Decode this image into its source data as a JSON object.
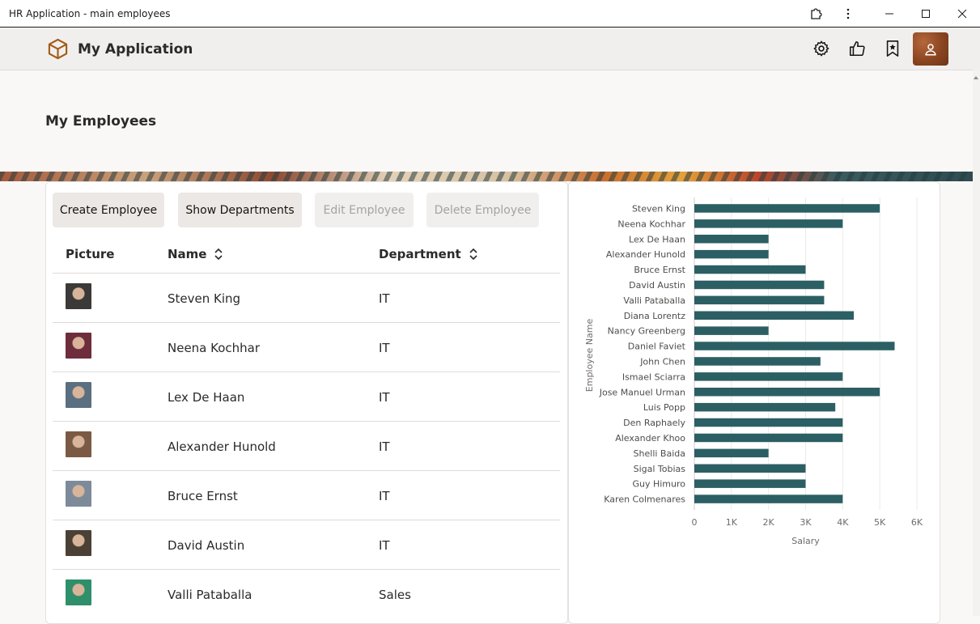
{
  "window": {
    "title": "HR Application - main employees"
  },
  "app": {
    "name": "My Application"
  },
  "page": {
    "title": "My Employees"
  },
  "toolbar": {
    "create_label": "Create Employee",
    "show_departments_label": "Show Departments",
    "edit_label": "Edit Employee",
    "delete_label": "Delete Employee"
  },
  "table": {
    "headers": {
      "picture": "Picture",
      "name": "Name",
      "department": "Department"
    },
    "rows": [
      {
        "name": "Steven King",
        "department": "IT",
        "photo_tone": "#3b3a38"
      },
      {
        "name": "Neena Kochhar",
        "department": "IT",
        "photo_tone": "#6d2d3a"
      },
      {
        "name": "Lex De Haan",
        "department": "IT",
        "photo_tone": "#5a6f80"
      },
      {
        "name": "Alexander Hunold",
        "department": "IT",
        "photo_tone": "#7a5a44"
      },
      {
        "name": "Bruce Ernst",
        "department": "IT",
        "photo_tone": "#7d8a99"
      },
      {
        "name": "David Austin",
        "department": "IT",
        "photo_tone": "#4a4035"
      },
      {
        "name": "Valli Pataballa",
        "department": "Sales",
        "photo_tone": "#2f8f6a"
      }
    ]
  },
  "colors": {
    "bar": "#2b5f64",
    "accent_avatar": "#8a4520",
    "logo": "#a35a16"
  },
  "chart_data": {
    "type": "bar",
    "orientation": "horizontal",
    "categories": [
      "Steven King",
      "Neena Kochhar",
      "Lex De Haan",
      "Alexander Hunold",
      "Bruce Ernst",
      "David Austin",
      "Valli Pataballa",
      "Diana Lorentz",
      "Nancy Greenberg",
      "Daniel Faviet",
      "John Chen",
      "Ismael Sciarra",
      "Jose Manuel Urman",
      "Luis Popp",
      "Den Raphaely",
      "Alexander Khoo",
      "Shelli Baida",
      "Sigal Tobias",
      "Guy Himuro",
      "Karen Colmenares"
    ],
    "values": [
      5000,
      4000,
      2000,
      2000,
      3000,
      3500,
      3500,
      4300,
      2000,
      5400,
      3400,
      4000,
      5000,
      3800,
      4000,
      4000,
      2000,
      3000,
      3000,
      4000
    ],
    "xlabel": "Salary",
    "ylabel": "Employee Name",
    "xlim": [
      0,
      6000
    ],
    "ticks": [
      "0",
      "1K",
      "2K",
      "3K",
      "4K",
      "5K",
      "6K"
    ],
    "grid": true
  }
}
